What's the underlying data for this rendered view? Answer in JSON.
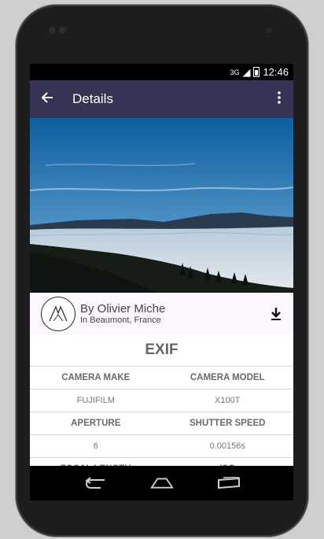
{
  "status_bar": {
    "signal": "3G",
    "time": "12:46"
  },
  "app_bar": {
    "title": "Details"
  },
  "author": {
    "name": "By Olivier Miche",
    "location": "In Beaumont, France"
  },
  "exif": {
    "title": "EXIF",
    "rows": [
      {
        "type": "header",
        "left": "CAMERA MAKE",
        "right": "CAMERA MODEL"
      },
      {
        "type": "value",
        "left": "FUJIFILM",
        "right": "X100T"
      },
      {
        "type": "header",
        "left": "APERTURE",
        "right": "SHUTTER SPEED"
      },
      {
        "type": "value",
        "left": "6",
        "right": "0.00156s"
      },
      {
        "type": "header",
        "left": "FOCAL LENGTH",
        "right": "ISO"
      }
    ]
  },
  "colors": {
    "app_bar": "#353455",
    "author_row_bg": "#fbf7fc",
    "sky_top": "#0e5f9e",
    "sea_of_clouds": "#d8e2ea"
  }
}
